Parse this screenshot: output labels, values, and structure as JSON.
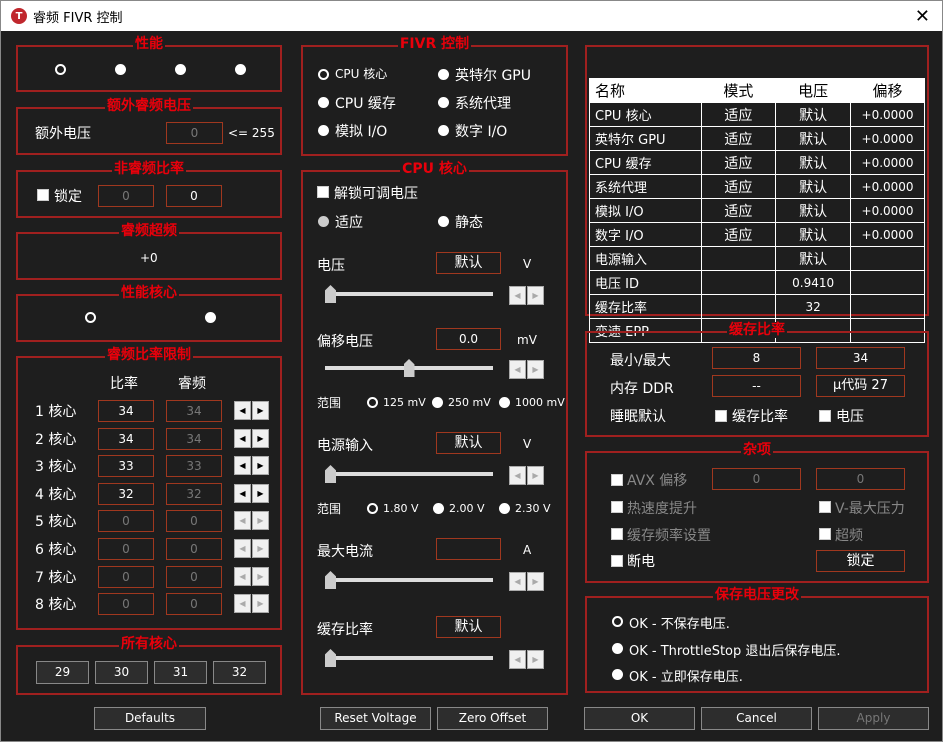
{
  "window": {
    "title": "睿频 FIVR 控制",
    "icon_letter": "T",
    "close": "✕"
  },
  "perf": {
    "title": "性能"
  },
  "extra_volt": {
    "title": "额外睿频电压",
    "label": "额外电压",
    "value": "0",
    "limit": "<= 255"
  },
  "non_turbo": {
    "title": "非睿频比率",
    "lock_label": "锁定",
    "value1": "0",
    "value2": "0"
  },
  "turbo_oc": {
    "title": "睿频超频",
    "value": "+0"
  },
  "perf_core": {
    "title": "性能核心"
  },
  "ratio_limits": {
    "title": "睿频比率限制",
    "col_ratio": "比率",
    "col_turbo": "睿频",
    "rows": [
      {
        "label": "1 核心",
        "ratio": "34",
        "turbo": "34",
        "enabled": true
      },
      {
        "label": "2 核心",
        "ratio": "34",
        "turbo": "34",
        "enabled": true
      },
      {
        "label": "3 核心",
        "ratio": "33",
        "turbo": "33",
        "enabled": true
      },
      {
        "label": "4 核心",
        "ratio": "32",
        "turbo": "32",
        "enabled": true
      },
      {
        "label": "5 核心",
        "ratio": "0",
        "turbo": "0",
        "enabled": false
      },
      {
        "label": "6 核心",
        "ratio": "0",
        "turbo": "0",
        "enabled": false
      },
      {
        "label": "7 核心",
        "ratio": "0",
        "turbo": "0",
        "enabled": false
      },
      {
        "label": "8 核心",
        "ratio": "0",
        "turbo": "0",
        "enabled": false
      }
    ]
  },
  "all_cores": {
    "title": "所有核心",
    "buttons": [
      "29",
      "30",
      "31",
      "32"
    ]
  },
  "fivr_control": {
    "title": "FIVR 控制",
    "options": [
      "CPU 核心",
      "英特尔 GPU",
      "CPU 缓存",
      "系统代理",
      "模拟 I/O",
      "数字 I/O"
    ],
    "selected": "CPU 核心"
  },
  "cpu_core": {
    "title": "CPU 核心",
    "unlock_label": "解锁可调电压",
    "adaptive": "适应",
    "static": "静态",
    "voltage": {
      "label": "电压",
      "value": "默认",
      "unit": "V",
      "slider": 0
    },
    "offset": {
      "label": "偏移电压",
      "value": "0.0",
      "unit": "mV",
      "slider": 0.5
    },
    "offset_range": {
      "label": "范围",
      "options": [
        "125 mV",
        "250 mV",
        "1000 mV"
      ],
      "selected": "125 mV"
    },
    "power_input": {
      "label": "电源输入",
      "value": "默认",
      "unit": "V",
      "slider": 0
    },
    "power_range": {
      "label": "范围",
      "options": [
        "1.80 V",
        "2.00 V",
        "2.30 V"
      ],
      "selected": "1.80 V"
    },
    "max_current": {
      "label": "最大电流",
      "value": "",
      "unit": "A",
      "slider": 0
    },
    "cache_ratio": {
      "label": "缓存比率",
      "value": "默认",
      "slider": 0
    }
  },
  "table": {
    "headers": [
      "名称",
      "模式",
      "电压",
      "偏移"
    ],
    "rows": [
      [
        "CPU 核心",
        "适应",
        "默认",
        "+0.0000"
      ],
      [
        "英特尔 GPU",
        "适应",
        "默认",
        "+0.0000"
      ],
      [
        "CPU 缓存",
        "适应",
        "默认",
        "+0.0000"
      ],
      [
        "系统代理",
        "适应",
        "默认",
        "+0.0000"
      ],
      [
        "模拟 I/O",
        "适应",
        "默认",
        "+0.0000"
      ],
      [
        "数字 I/O",
        "适应",
        "默认",
        "+0.0000"
      ],
      [
        "电源输入",
        "",
        "默认",
        ""
      ],
      [
        "电压 ID",
        "",
        "0.9410",
        ""
      ],
      [
        "缓存比率",
        "",
        "32",
        ""
      ],
      [
        "变速 EPP",
        "",
        "",
        ""
      ]
    ]
  },
  "cache_ratio": {
    "title": "缓存比率",
    "minmax_label": "最小/最大",
    "min": "8",
    "max": "34",
    "ddr_label": "内存 DDR",
    "ddr_value": "--",
    "microcode": "μ代码 27",
    "sleep_label": "睡眠默认",
    "sleep_cache": "缓存比率",
    "sleep_volt": "电压"
  },
  "misc": {
    "title": "杂项",
    "avx_label": "AVX 偏移",
    "avx1": "0",
    "avx2": "0",
    "thermal": "热速度提升",
    "vmax": "V-最大压力",
    "cache_freq": "缓存频率设置",
    "oc": "超频",
    "power_off": "断电",
    "lock_btn": "锁定"
  },
  "save": {
    "title": "保存电压更改",
    "options": [
      "OK - 不保存电压.",
      "OK - ThrottleStop 退出后保存电压.",
      "OK - 立即保存电压."
    ],
    "selected": 0
  },
  "buttons": {
    "defaults": "Defaults",
    "reset": "Reset Voltage",
    "zero": "Zero Offset",
    "ok": "OK",
    "cancel": "Cancel",
    "apply": "Apply"
  }
}
